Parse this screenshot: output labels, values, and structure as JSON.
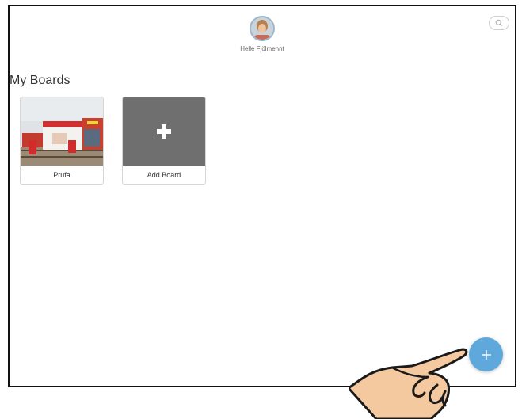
{
  "profile": {
    "name": "Helle Fjölmennt"
  },
  "section": {
    "title": "My Boards"
  },
  "boards": [
    {
      "label": "Prufa"
    },
    {
      "label": "Add Board"
    }
  ],
  "icons": {
    "search": "search-icon",
    "add_board": "plus-icon",
    "fab": "plus-icon",
    "pointer": "hand-pointer-icon"
  },
  "colors": {
    "fab": "#5fa8dc",
    "add_board_tile": "#6f6f6f",
    "avatar_ring": "#9fb7cc"
  }
}
